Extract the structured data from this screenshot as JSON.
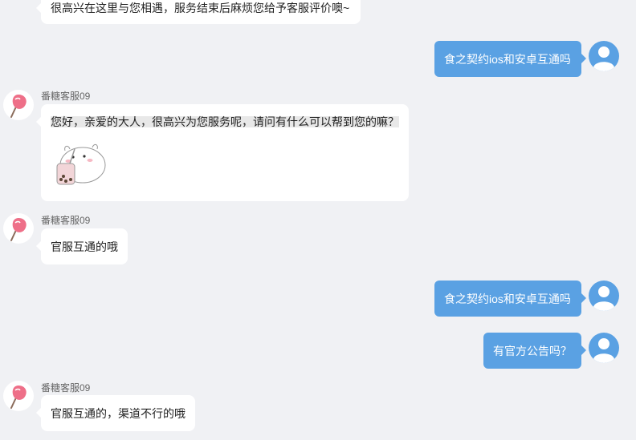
{
  "colors": {
    "background": "#f0f1f4",
    "user_bubble": "#5aa1e3",
    "agent_bubble": "#ffffff",
    "candy": "#ee6f88"
  },
  "messages": {
    "m0": {
      "text": "很高兴在这里与您相遇，服务结束后麻烦您给予客服评价噢~"
    },
    "m1": {
      "text": "食之契约ios和安卓互通吗"
    },
    "m2": {
      "sender": "番糖客服09",
      "text": "您好，亲爱的大人，很高兴为您服务呢，请问有什么可以帮到您的嘛？",
      "sticker": "hamster-bubble-tea-sticker"
    },
    "m3": {
      "sender": "番糖客服09",
      "text": "官服互通的哦"
    },
    "m4": {
      "text": "食之契约ios和安卓互通吗"
    },
    "m5": {
      "text": "有官方公告吗？"
    },
    "m6": {
      "sender": "番糖客服09",
      "text": "官服互通的，渠道不行的哦"
    }
  },
  "icons": {
    "agent_avatar": "candy-icon",
    "user_avatar": "user-silhouette-icon"
  }
}
